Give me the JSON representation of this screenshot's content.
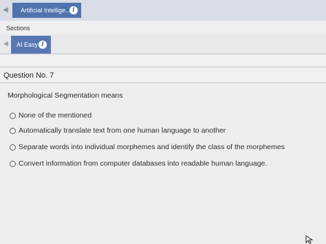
{
  "top_tab": {
    "label": "Artificial Intellige...",
    "info": "i"
  },
  "sections": {
    "label": "Sections"
  },
  "section_tab": {
    "label": "AI Easy",
    "info": "i"
  },
  "question": {
    "title": "Question No. 7",
    "text": "Morphological Segmentation means",
    "options": [
      "None of the mentioned",
      "Automatically translate text from one human language to another",
      "Separate words into individual morphemes and identify the class of the morphemes",
      "Convert information from computer databases into readable human language."
    ]
  },
  "colors": {
    "tab_blue": "#4f73ad",
    "background": "#eceef0"
  },
  "icons": [
    "left-arrow-icon",
    "info-icon",
    "radio-icon",
    "mouse-cursor-icon"
  ]
}
